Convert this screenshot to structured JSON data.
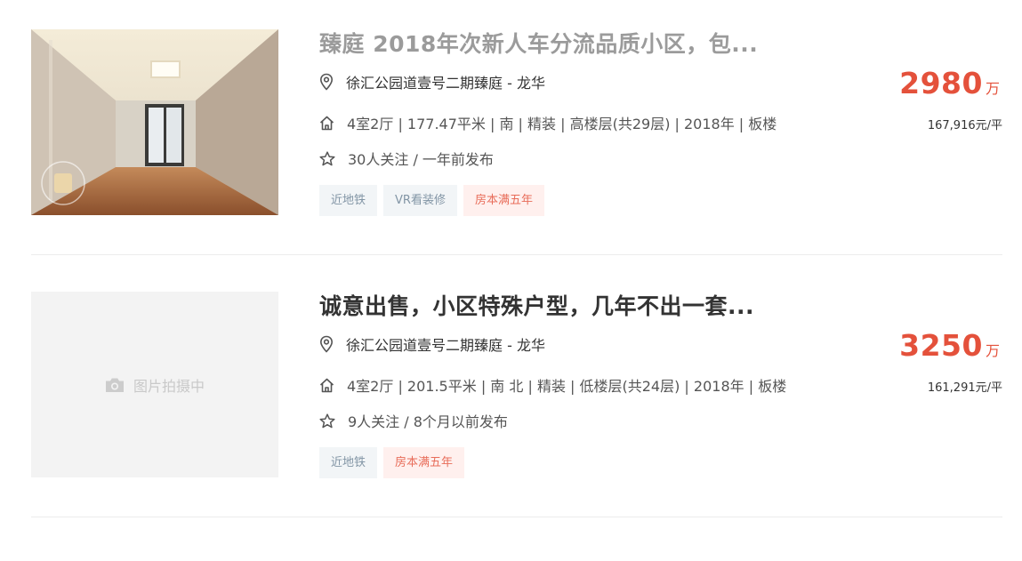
{
  "listings": [
    {
      "title": "臻庭 2018年次新人车分流品质小区，包...",
      "address": "徐汇公园道壹号二期臻庭 - 龙华",
      "house_info": "4室2厅 | 177.47平米 | 南 | 精装 | 高楼层(共29层) | 2018年 | 板楼",
      "follow_info": "30人关注 / 一年前发布",
      "tags": [
        "近地铁",
        "VR看装修",
        "房本满五年"
      ],
      "total_price": "2980",
      "total_unit": "万",
      "unit_price": "167,916元/平",
      "image": "living-room-photo"
    },
    {
      "title": "诚意出售，小区特殊户型，几年不出一套...",
      "address": "徐汇公园道壹号二期臻庭 - 龙华",
      "house_info": "4室2厅 | 201.5平米 | 南 北 | 精装 | 低楼层(共24层) | 2018年 | 板楼",
      "follow_info": "9人关注 / 8个月以前发布",
      "tags": [
        "近地铁",
        "房本满五年"
      ],
      "total_price": "3250",
      "total_unit": "万",
      "unit_price": "161,291元/平",
      "image_placeholder": "图片拍摄中"
    }
  ],
  "colors": {
    "price": "#e4513b",
    "title_visited": "#9b9b9b",
    "title": "#333333",
    "tag_bg": "#f2f5f7",
    "tag_text": "#8295a5",
    "tag_red_bg": "#fff0ee",
    "tag_red_text": "#e86d5a"
  },
  "icons": {
    "address": "location-pin-icon",
    "house_info": "house-icon",
    "follow": "star-icon",
    "placeholder": "camera-icon",
    "vr_badge": "vr-icon"
  }
}
